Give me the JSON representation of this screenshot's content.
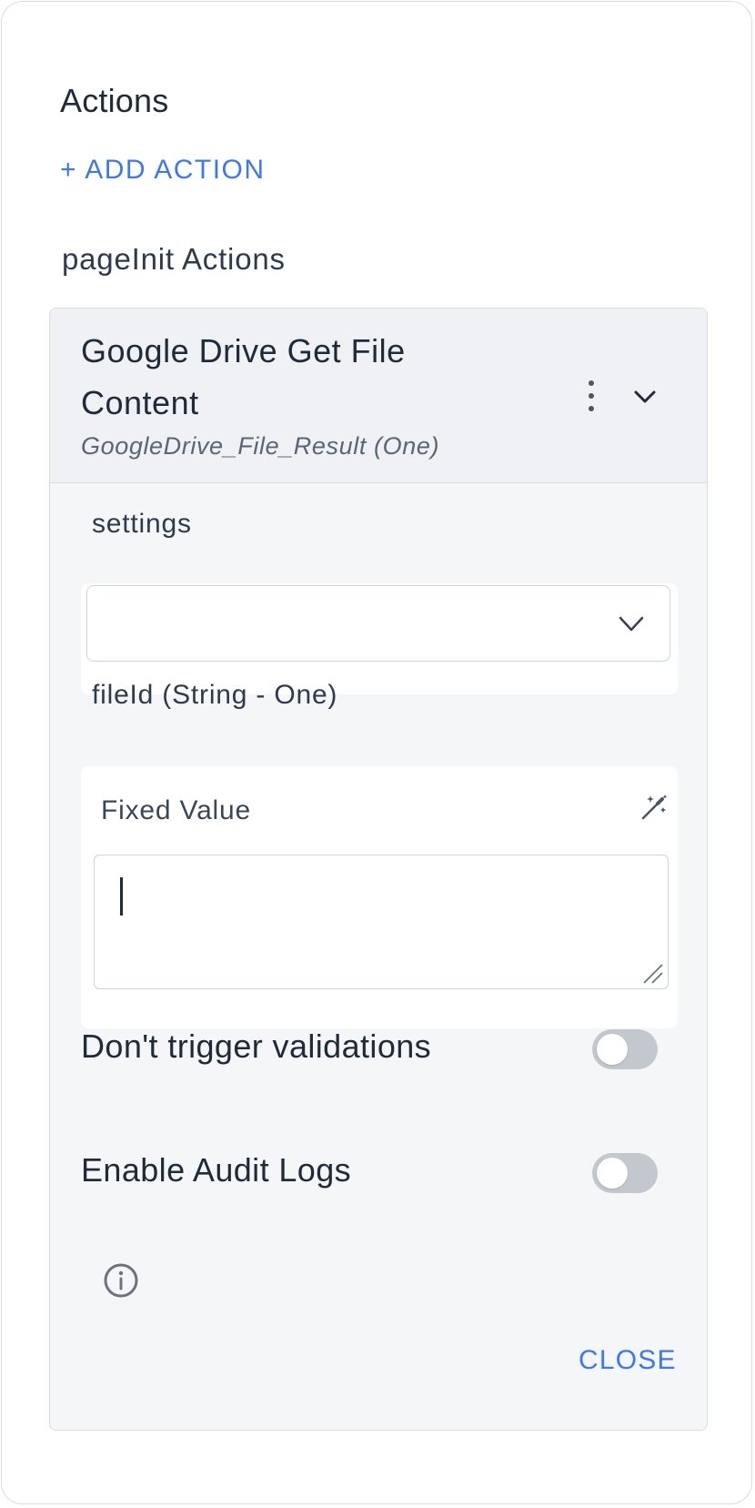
{
  "header": {
    "title": "Actions",
    "add_action_label": "+ ADD ACTION"
  },
  "section": {
    "label": "pageInit Actions"
  },
  "action_card": {
    "title": "Google Drive Get File Content",
    "subtitle": "GoogleDrive_File_Result (One)",
    "icons": {
      "menu": "more-vertical-icon",
      "expand": "chevron-up-icon"
    }
  },
  "fields": {
    "settings_label": "settings",
    "settings_value": "",
    "fileid_label": "fileId (String - One)",
    "fileid_mode_label": "Fixed Value",
    "fileid_value": ""
  },
  "toggles": [
    {
      "label": "Don't trigger validations",
      "on": false
    },
    {
      "label": "Enable Audit Logs",
      "on": false
    }
  ],
  "footer": {
    "close_label": "CLOSE",
    "info_icon": "info-icon"
  },
  "colors": {
    "accent": "#3b78f2",
    "toggle_off": "#c3c8cf",
    "card_bg": "#f5f6f8"
  }
}
